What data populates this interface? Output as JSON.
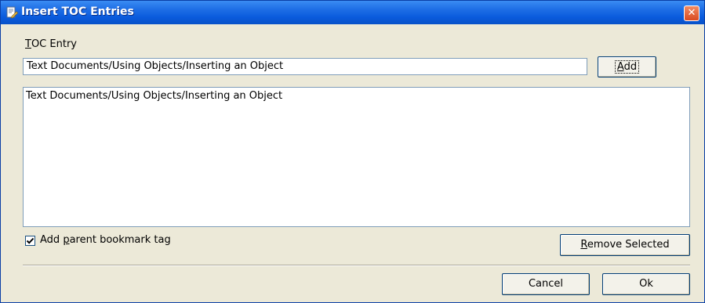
{
  "window": {
    "title": "Insert TOC Entries",
    "close_symbol": "✕"
  },
  "toc_entry": {
    "label_mnemonic": "T",
    "label_rest": "OC Entry",
    "value": "Text Documents/Using Objects/Inserting an Object"
  },
  "buttons": {
    "add_mnemonic": "A",
    "add_rest": "dd",
    "remove_mnemonic": "R",
    "remove_rest": "emove Selected",
    "cancel": "Cancel",
    "ok": "Ok"
  },
  "entries_list": {
    "items": [
      "Text Documents/Using Objects/Inserting an Object"
    ]
  },
  "parent_bookmark": {
    "checked": true,
    "label_prefix": "Add ",
    "label_mnemonic": "p",
    "label_rest": "arent bookmark tag"
  },
  "icons": {
    "title": "document-edit-icon",
    "close": "close-icon",
    "check": "check-icon"
  }
}
